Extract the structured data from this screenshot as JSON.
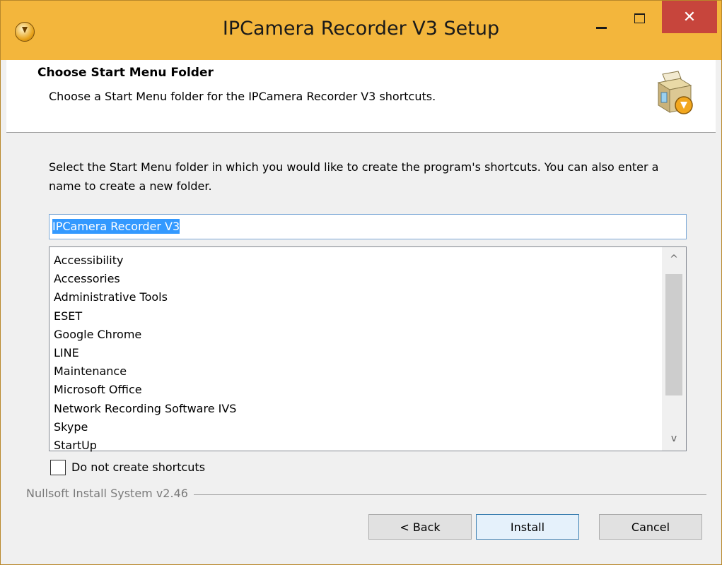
{
  "window": {
    "title": "IPCamera Recorder V3 Setup",
    "close_glyph": "✕"
  },
  "header": {
    "title": "Choose Start Menu Folder",
    "subtitle": "Choose a Start Menu folder for the IPCamera Recorder V3 shortcuts.",
    "icon": "installer-box-icon"
  },
  "content": {
    "description": "Select the Start Menu folder in which you would like to create the program's shortcuts. You can also enter a name to create a new folder.",
    "folder_input_value": "IPCamera Recorder V3",
    "folders": [
      "Accessibility",
      "Accessories",
      "Administrative Tools",
      "ESET",
      "Google Chrome",
      "LINE",
      "Maintenance",
      "Microsoft Office",
      "Network Recording Software IVS",
      "Skype",
      "StartUp"
    ],
    "scroll_up_glyph": "^",
    "scroll_down_glyph": "v",
    "no_shortcuts_label": "Do not create shortcuts",
    "no_shortcuts_checked": false
  },
  "footer": {
    "branding": "Nullsoft Install System v2.46",
    "back_label": "< Back",
    "install_label": "Install",
    "cancel_label": "Cancel"
  },
  "colors": {
    "titlebar": "#f3b63c",
    "close_button": "#c7453c",
    "selection": "#3399ff",
    "default_button_border": "#3c7fb1"
  }
}
